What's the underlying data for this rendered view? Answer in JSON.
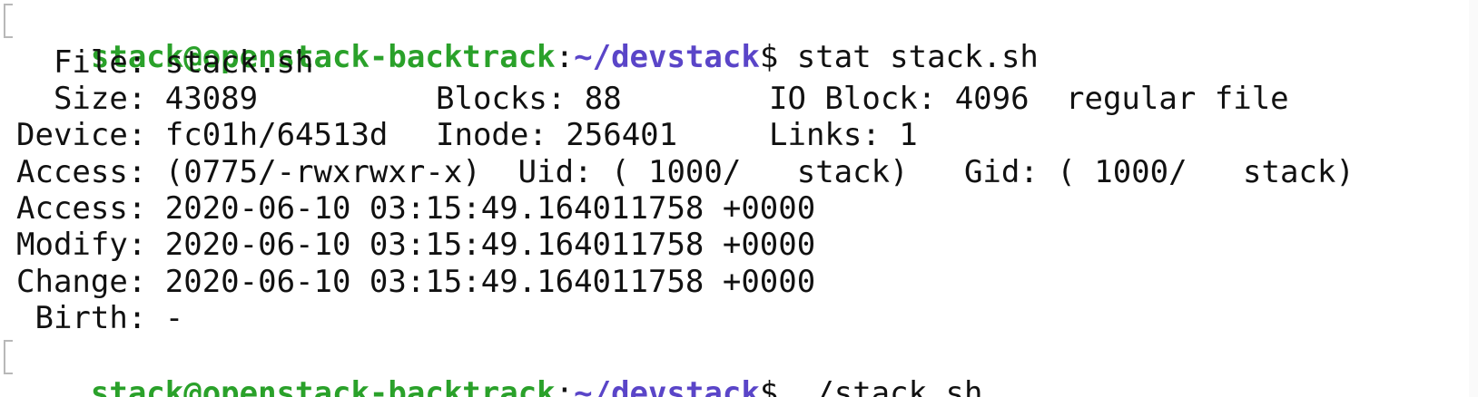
{
  "terminal": {
    "prompts": [
      {
        "user_host": "stack@openstack-backtrack",
        "sep": ":",
        "path": "~/devstack",
        "dollar": "$ ",
        "command": "stat stack.sh"
      },
      {
        "user_host": "stack@openstack-backtrack",
        "sep": ":",
        "path": "~/devstack",
        "dollar": "$ ",
        "command": "./stack.sh"
      }
    ],
    "stat_output": {
      "file_line": "  File: stack.sh",
      "size": "  Size: 43089",
      "blocks": "Blocks: 88",
      "io_block": "IO Block: 4096",
      "file_type": "regular file",
      "device": "Device: fc01h/64513d",
      "inode": "Inode: 256401",
      "links": "Links: 1",
      "access_perm": "Access: (0775/-rwxrwxr-x)  Uid: ( 1000/   stack)   Gid: ( 1000/   stack)",
      "access_time": "Access: 2020-06-10 03:15:49.164011758 +0000",
      "modify_time": "Modify: 2020-06-10 03:15:49.164011758 +0000",
      "change_time": "Change: 2020-06-10 03:15:49.164011758 +0000",
      "birth": " Birth: -"
    }
  },
  "colors": {
    "background": "#ffffff",
    "text": "#111111",
    "prompt_user": "#2aa12a",
    "prompt_path": "#5a45c8"
  }
}
